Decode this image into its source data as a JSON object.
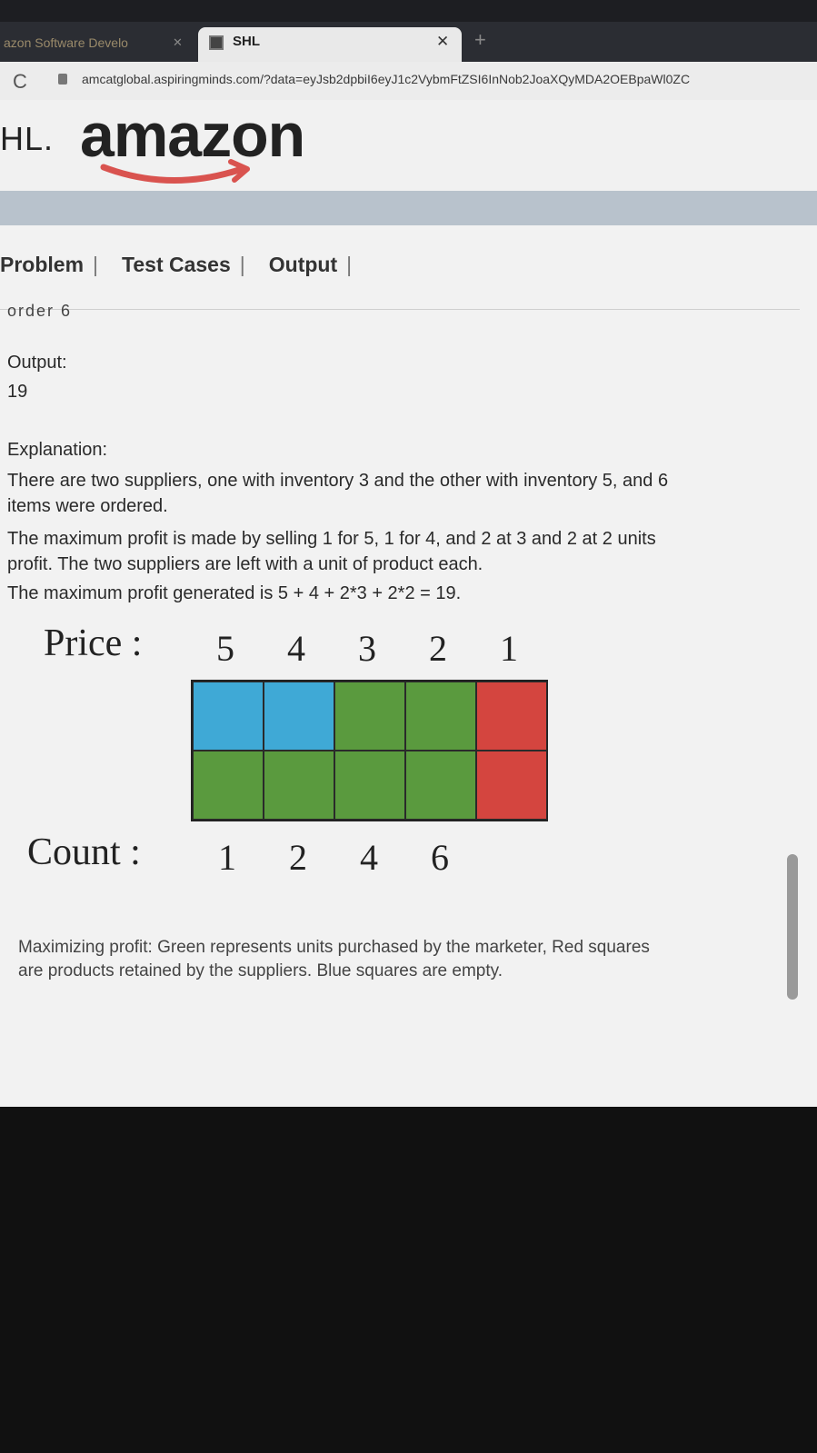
{
  "browser": {
    "inactive_tab_label": "azon Software Develo",
    "active_tab_label": "SHL",
    "url": "amcatglobal.aspiringminds.com/?data=eyJsb2dpbiI6eyJ1c2VybmFtZSI6InNob2JoaXQyMDA2OEBpaWl0ZC"
  },
  "header": {
    "shl_logo": "HL.",
    "amazon_logo": "amazon"
  },
  "nav": {
    "tabs": [
      "Problem",
      "Test Cases",
      "Output"
    ],
    "separator": "|"
  },
  "content": {
    "cutoff_text": "order 6",
    "output_label": "Output:",
    "output_value": "19",
    "explanation_label": "Explanation:",
    "line1": "There are two suppliers, one with inventory 3 and the other with inventory 5, and 6",
    "line2": "items were ordered.",
    "line3": "The maximum profit is made by selling 1 for 5, 1 for 4, and 2 at 3 and 2 at 2 units",
    "line4": "profit.  The two suppliers are left with a unit of product each.",
    "line5": "The maximum profit generated is 5 + 4 + 2*3 + 2*2 = 19."
  },
  "figure": {
    "price_label": "Price :",
    "prices": [
      "5",
      "4",
      "3",
      "2",
      "1"
    ],
    "count_label": "Count :",
    "counts": [
      "1",
      "2",
      "4",
      "6"
    ],
    "rows": [
      [
        "blue",
        "blue",
        "green",
        "green",
        "red"
      ],
      [
        "green",
        "green",
        "green",
        "green",
        "red"
      ]
    ],
    "colors": {
      "blue": "#3fa9d6",
      "green": "#5a9a3e",
      "red": "#d4453f"
    },
    "caption_line1": "Maximizing profit: Green represents units purchased by the marketer, Red squares",
    "caption_line2": "are products retained by the suppliers. Blue squares are empty."
  }
}
